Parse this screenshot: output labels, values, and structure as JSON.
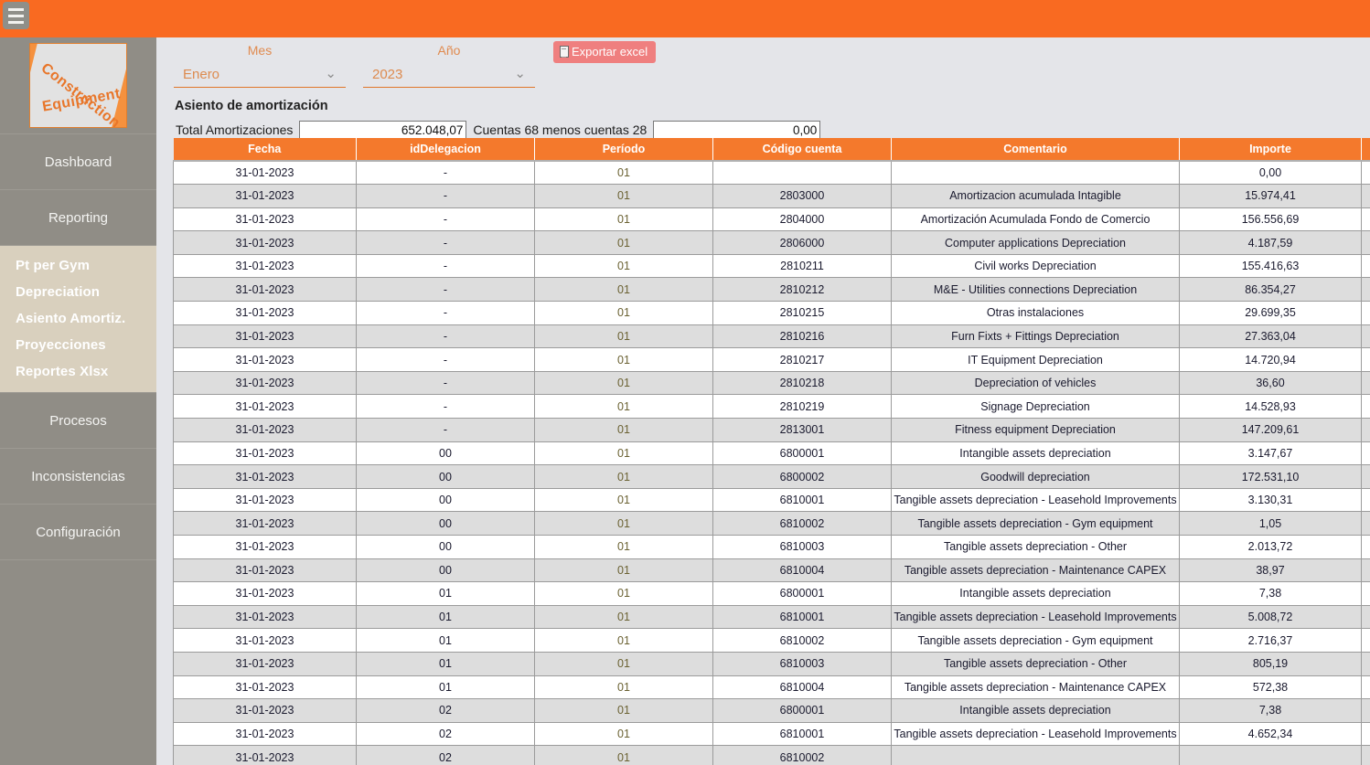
{
  "app": {
    "menu_icon": "hamburger-icon",
    "logo_text_line1": "Construction",
    "logo_text_line2": "Equipment"
  },
  "sidebar": {
    "items": [
      {
        "label": "Dashboard"
      },
      {
        "label": "Reporting"
      },
      {
        "label": "Procesos"
      },
      {
        "label": "Inconsistencias"
      },
      {
        "label": "Configuración"
      }
    ],
    "submenu": [
      {
        "label": "Pt per Gym"
      },
      {
        "label": "Depreciation"
      },
      {
        "label": "Asiento Amortiz."
      },
      {
        "label": "Proyecciones"
      },
      {
        "label": "Reportes Xlsx"
      }
    ]
  },
  "filters": {
    "mes_label": "Mes",
    "mes_value": "Enero",
    "anio_label": "Año",
    "anio_value": "2023",
    "chevron": "⌄",
    "export_label": "Exportar excel"
  },
  "section": {
    "title": "Asiento de amortización",
    "total_label": "Total Amortizaciones",
    "total_value": "652.048,07",
    "cuentas_label": "Cuentas 68 menos cuentas 28",
    "cuentas_value": "0,00"
  },
  "table": {
    "columns": [
      "Fecha",
      "idDelegacion",
      "Período",
      "Código cuenta",
      "Comentario",
      "Importe"
    ],
    "rows": [
      [
        "31-01-2023",
        "-",
        "01",
        "",
        "",
        "0,00"
      ],
      [
        "31-01-2023",
        "-",
        "01",
        "2803000",
        "Amortizacion acumulada Intagible",
        "15.974,41"
      ],
      [
        "31-01-2023",
        "-",
        "01",
        "2804000",
        "Amortización Acumulada Fondo de Comercio",
        "156.556,69"
      ],
      [
        "31-01-2023",
        "-",
        "01",
        "2806000",
        "Computer applications Depreciation",
        "4.187,59"
      ],
      [
        "31-01-2023",
        "-",
        "01",
        "2810211",
        "Civil works Depreciation",
        "155.416,63"
      ],
      [
        "31-01-2023",
        "-",
        "01",
        "2810212",
        "M&E - Utilities connections Depreciation",
        "86.354,27"
      ],
      [
        "31-01-2023",
        "-",
        "01",
        "2810215",
        "Otras instalaciones",
        "29.699,35"
      ],
      [
        "31-01-2023",
        "-",
        "01",
        "2810216",
        "Furn Fixts + Fittings Depreciation",
        "27.363,04"
      ],
      [
        "31-01-2023",
        "-",
        "01",
        "2810217",
        "IT Equipment Depreciation",
        "14.720,94"
      ],
      [
        "31-01-2023",
        "-",
        "01",
        "2810218",
        "Depreciation of vehicles",
        "36,60"
      ],
      [
        "31-01-2023",
        "-",
        "01",
        "2810219",
        "Signage Depreciation",
        "14.528,93"
      ],
      [
        "31-01-2023",
        "-",
        "01",
        "2813001",
        "Fitness equipment Depreciation",
        "147.209,61"
      ],
      [
        "31-01-2023",
        "00",
        "01",
        "6800001",
        "Intangible assets depreciation",
        "3.147,67"
      ],
      [
        "31-01-2023",
        "00",
        "01",
        "6800002",
        "Goodwill depreciation",
        "172.531,10"
      ],
      [
        "31-01-2023",
        "00",
        "01",
        "6810001",
        "Tangible assets depreciation - Leasehold Improvements",
        "3.130,31"
      ],
      [
        "31-01-2023",
        "00",
        "01",
        "6810002",
        "Tangible assets depreciation - Gym equipment",
        "1,05"
      ],
      [
        "31-01-2023",
        "00",
        "01",
        "6810003",
        "Tangible assets depreciation - Other",
        "2.013,72"
      ],
      [
        "31-01-2023",
        "00",
        "01",
        "6810004",
        "Tangible assets depreciation - Maintenance CAPEX",
        "38,97"
      ],
      [
        "31-01-2023",
        "01",
        "01",
        "6800001",
        "Intangible assets depreciation",
        "7,38"
      ],
      [
        "31-01-2023",
        "01",
        "01",
        "6810001",
        "Tangible assets depreciation - Leasehold Improvements",
        "5.008,72"
      ],
      [
        "31-01-2023",
        "01",
        "01",
        "6810002",
        "Tangible assets depreciation - Gym equipment",
        "2.716,37"
      ],
      [
        "31-01-2023",
        "01",
        "01",
        "6810003",
        "Tangible assets depreciation - Other",
        "805,19"
      ],
      [
        "31-01-2023",
        "01",
        "01",
        "6810004",
        "Tangible assets depreciation - Maintenance CAPEX",
        "572,38"
      ],
      [
        "31-01-2023",
        "02",
        "01",
        "6800001",
        "Intangible assets depreciation",
        "7,38"
      ],
      [
        "31-01-2023",
        "02",
        "01",
        "6810001",
        "Tangible assets depreciation - Leasehold Improvements",
        "4.652,34"
      ],
      [
        "31-01-2023",
        "02",
        "01",
        "6810002",
        "",
        ""
      ]
    ]
  },
  "colors": {
    "brand_orange": "#f96a21",
    "table_header_orange": "#f4792c",
    "sidebar_gray": "#908d86",
    "submenu_beige": "#d9d0be",
    "export_salmon": "#ef7f7f",
    "content_bg": "#e4e5e9"
  }
}
